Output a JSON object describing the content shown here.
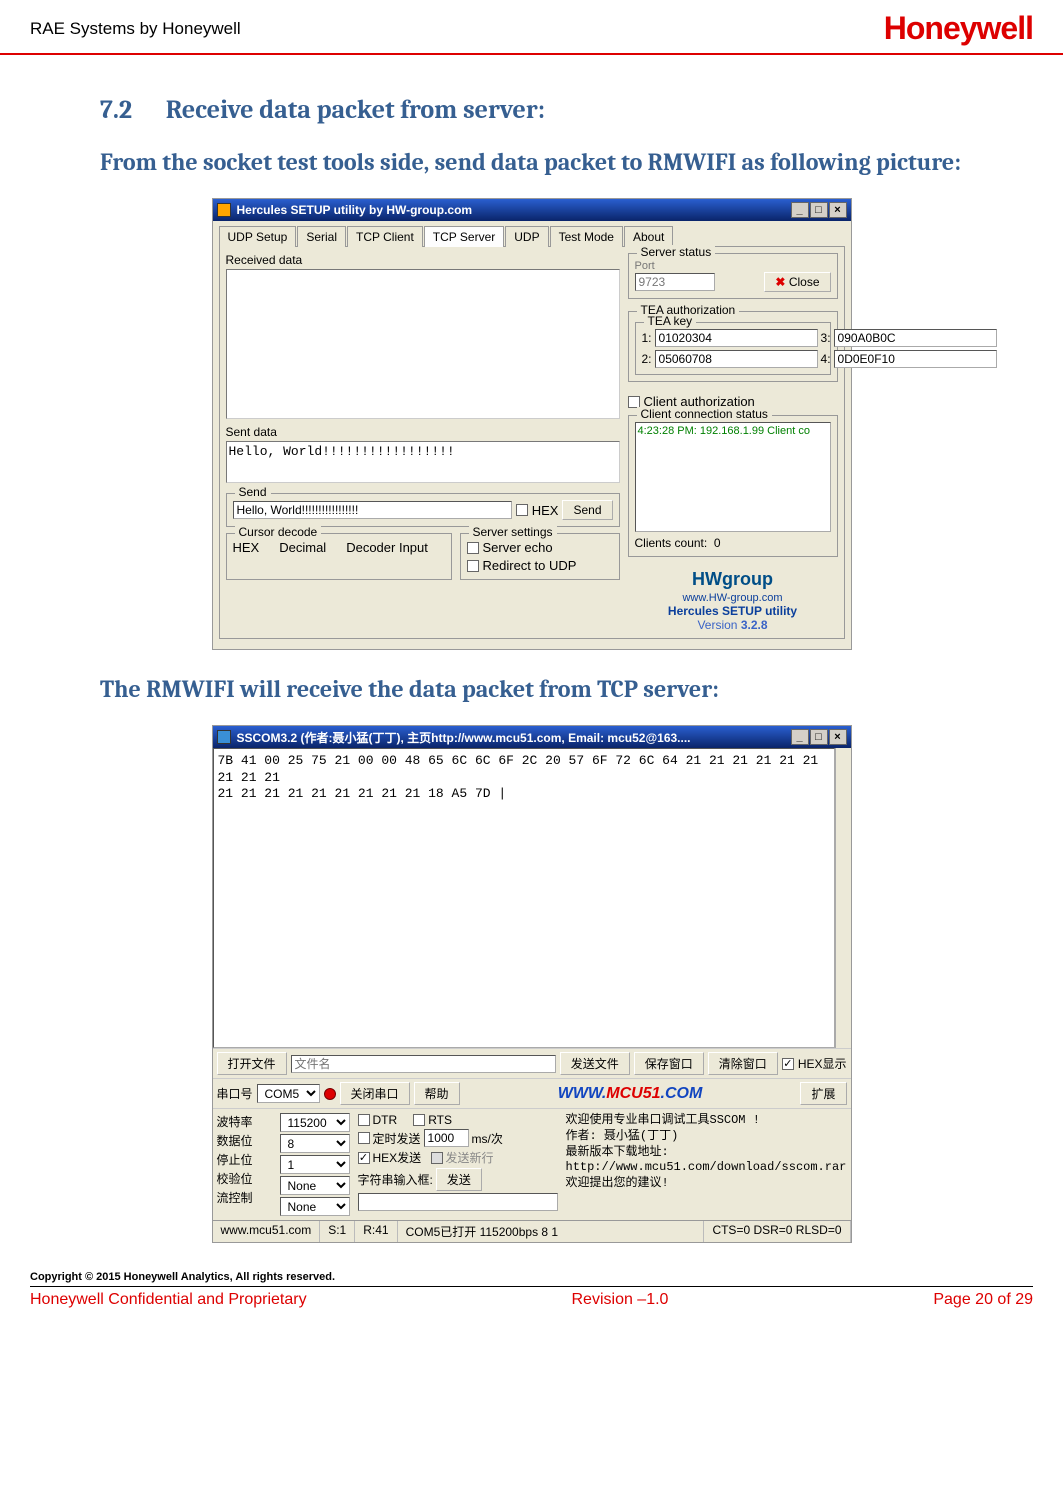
{
  "page": {
    "header_left": "RAE Systems by Honeywell",
    "header_right": "Honeywell",
    "section_number": "7.2",
    "section_title": "Receive data packet from server:",
    "intro": "From the socket test tools side, send data packet to RMWIFI as following picture:",
    "mid": "The RMWIFI will receive the data packet from TCP server:",
    "copyright": "Copyright © 2015 Honeywell Analytics, All rights reserved.",
    "footer_left": "Honeywell Confidential and Proprietary",
    "footer_center": "Revision –1.0",
    "footer_right": "Page 20 of 29"
  },
  "hercules": {
    "title": "Hercules SETUP utility by HW-group.com",
    "tabs": [
      "UDP Setup",
      "Serial",
      "TCP Client",
      "TCP Server",
      "UDP",
      "Test Mode",
      "About"
    ],
    "active_tab": "TCP Server",
    "received_label": "Received data",
    "sent_label": "Sent data",
    "sent_text": "Hello, World!!!!!!!!!!!!!!!!!",
    "server_status": {
      "group": "Server status",
      "port_label": "Port",
      "port": "9723",
      "close_btn": "Close"
    },
    "tea": {
      "group": "TEA authorization",
      "key_group": "TEA key",
      "k1_label": "1:",
      "k1": "01020304",
      "k2_label": "2:",
      "k2": "05060708",
      "k3_label": "3:",
      "k3": "090A0B0C",
      "k4_label": "4:",
      "k4": "0D0E0F10"
    },
    "client_auth": {
      "label": "Client authorization"
    },
    "client_conn": {
      "group": "Client connection status",
      "entry": "4:23:28 PM:  192.168.1.99 Client co",
      "count_label": "Clients count:",
      "count": "0"
    },
    "send": {
      "group": "Send",
      "value": "Hello, World!!!!!!!!!!!!!!!!!",
      "hex": "HEX",
      "button": "Send"
    },
    "cursor": {
      "group": "Cursor decode",
      "hex": "HEX",
      "decimal": "Decimal",
      "decoder": "Decoder Input"
    },
    "server_settings": {
      "group": "Server settings",
      "echo": "Server echo",
      "redirect": "Redirect to UDP"
    },
    "logo": {
      "brand_hw": "HW",
      "brand_grp": "group",
      "url": "www.HW-group.com",
      "util": "Hercules SETUP utility",
      "version_label": "Version",
      "version": "3.2.8"
    }
  },
  "sscom": {
    "title": "SSCOM3.2 (作者:聂小猛(丁丁), 主页http://www.mcu51.com,  Email: mcu52@163....",
    "term_text": "7B 41 00 25 75 21 00 00 48 65 6C 6C 6F 2C 20 57 6F 72 6C 64 21 21 21 21 21 21 21 21 21\n21 21 21 21 21 21 21 21 21 18 A5 7D |",
    "row1": {
      "open_file_btn": "打开文件",
      "file_label": "文件名",
      "send_file_btn": "发送文件",
      "save_win_btn": "保存窗口",
      "clear_win_btn": "清除窗口",
      "hex_show": "HEX显示"
    },
    "row2": {
      "com_label": "串口号",
      "com_value": "COM5",
      "close_port_btn": "关闭串口",
      "help_btn": "帮助",
      "mcu_w": "WWW.",
      "mcu_m": "MCU51",
      "mcu_c": ".COM",
      "ext_btn": "扩展"
    },
    "settings": {
      "baud_label": "波特率",
      "baud": "115200",
      "data_label": "数据位",
      "data": "8",
      "stop_label": "停止位",
      "stop": "1",
      "parity_label": "校验位",
      "parity": "None",
      "flow_label": "流控制",
      "flow": "None",
      "dtr": "DTR",
      "rts": "RTS",
      "timed": "定时发送",
      "interval": "1000",
      "interval_unit": "ms/次",
      "hex_send": "HEX发送",
      "send_new": "发送新行",
      "input_label": "字符串输入框:",
      "send2": "发送",
      "help_text": "欢迎使用专业串口调试工具SSCOM !\n作者: 聂小猛(丁丁)\n最新版本下载地址:\nhttp://www.mcu51.com/download/sscom.rar\n欢迎提出您的建议!"
    },
    "status": {
      "url": "www.mcu51.com",
      "s": "S:1",
      "r": "R:41",
      "port": "COM5已打开 115200bps 8 1",
      "cts": "CTS=0 DSR=0 RLSD=0"
    }
  }
}
